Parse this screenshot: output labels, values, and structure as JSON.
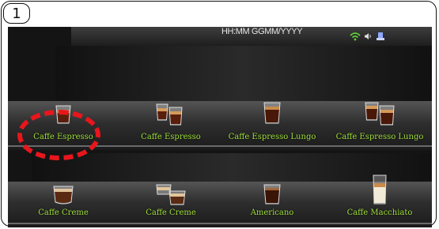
{
  "step": "1",
  "status_bar": {
    "time_date": "HH:MM GGMM/YYYY"
  },
  "shelves": [
    {
      "items": [
        {
          "label": "Caffe Espresso",
          "cup": "espresso"
        },
        {
          "label": "Caffe Espresso",
          "cup": "double-espresso"
        },
        {
          "label": "Caffe Espresso Lungo",
          "cup": "lungo"
        },
        {
          "label": "Caffe Espresso Lungo",
          "cup": "double-lungo"
        }
      ]
    },
    {
      "items": [
        {
          "label": "Caffe Creme",
          "cup": "creme"
        },
        {
          "label": "Caffe Creme",
          "cup": "double-creme"
        },
        {
          "label": "Americano",
          "cup": "americano"
        },
        {
          "label": "Caffe Macchiato",
          "cup": "macchiato"
        }
      ]
    }
  ],
  "highlighted_item": "shelf-1 item-1",
  "colors": {
    "label": "#9fe03a",
    "highlight": "#e8161c",
    "wifi": "#5fd43a"
  }
}
